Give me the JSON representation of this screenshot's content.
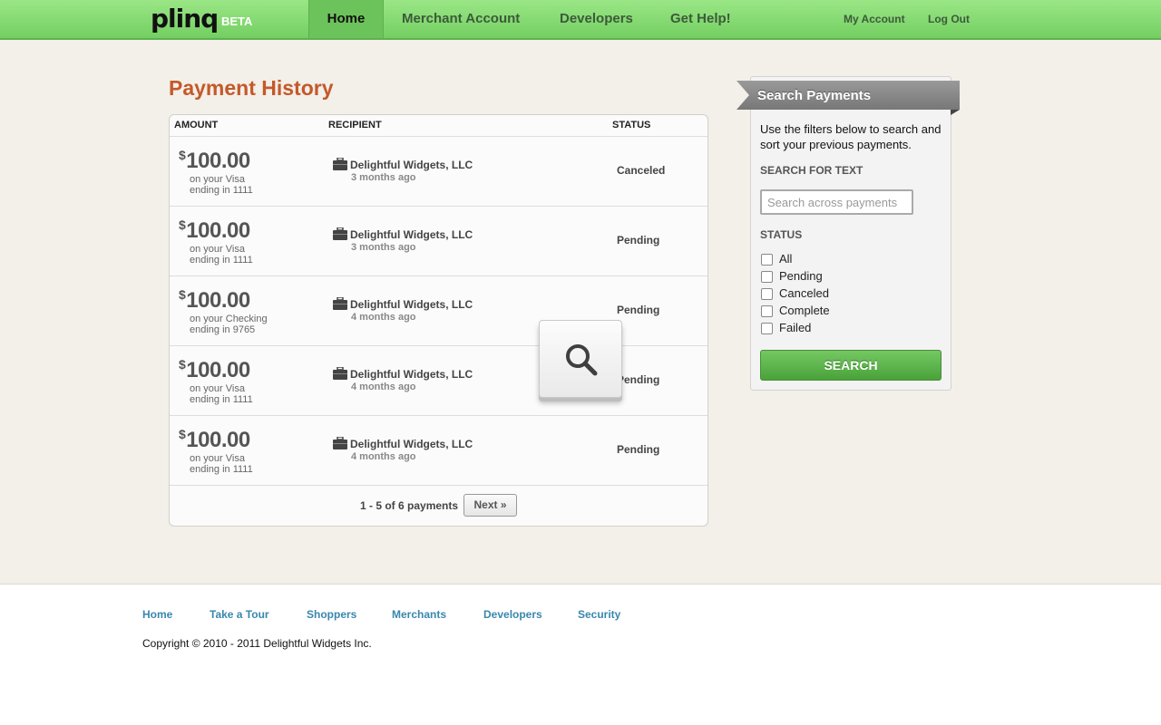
{
  "header": {
    "logo": "plinq",
    "badge": "BETA",
    "nav": [
      "Home",
      "Merchant Account",
      "Developers",
      "Get Help!"
    ],
    "account": "My Account",
    "logout": "Log Out"
  },
  "main": {
    "title": "Payment History",
    "columns": [
      "AMOUNT",
      "RECIPIENT",
      "STATUS"
    ],
    "payments": [
      {
        "currency": "$",
        "amount": "100.00",
        "method_line1": "on your Visa",
        "method_line2": "ending in 1111",
        "recipient": "Delightful Widgets, LLC",
        "time": "3 months ago",
        "status": "Canceled"
      },
      {
        "currency": "$",
        "amount": "100.00",
        "method_line1": "on your Visa",
        "method_line2": "ending in 1111",
        "recipient": "Delightful Widgets, LLC",
        "time": "3 months ago",
        "status": "Pending"
      },
      {
        "currency": "$",
        "amount": "100.00",
        "method_line1": "on your Checking",
        "method_line2": "ending in 9765",
        "recipient": "Delightful Widgets, LLC",
        "time": "4 months ago",
        "status": "Pending"
      },
      {
        "currency": "$",
        "amount": "100.00",
        "method_line1": "on your Visa",
        "method_line2": "ending in 1111",
        "recipient": "Delightful Widgets, LLC",
        "time": "4 months ago",
        "status": "Pending"
      },
      {
        "currency": "$",
        "amount": "100.00",
        "method_line1": "on your Visa",
        "method_line2": "ending in 1111",
        "recipient": "Delightful Widgets, LLC",
        "time": "4 months ago",
        "status": "Pending"
      }
    ],
    "pagination": {
      "summary": "1 - 5 of 6 payments",
      "next_label": "Next »"
    }
  },
  "search": {
    "title": "Search Payments",
    "description": "Use the filters below to search and sort your previous payments.",
    "text_label": "SEARCH FOR TEXT",
    "text_placeholder": "Search across payments",
    "status_label": "STATUS",
    "status_options": [
      "All",
      "Pending",
      "Canceled",
      "Complete",
      "Failed"
    ],
    "button_label": "SEARCH"
  },
  "footer": {
    "links": [
      "Home",
      "Take a Tour",
      "Shoppers",
      "Merchants",
      "Developers",
      "Security"
    ],
    "copyright": "Copyright © 2010 - 2011 Delightful Widgets Inc."
  },
  "colors": {
    "brand_green": "#74cf62",
    "title_orange": "#c4592a",
    "link_blue": "#3a87ad",
    "search_button": "#4aa23a"
  },
  "icons": {
    "bag": "briefcase-icon",
    "overlay": "magnifier-icon"
  }
}
